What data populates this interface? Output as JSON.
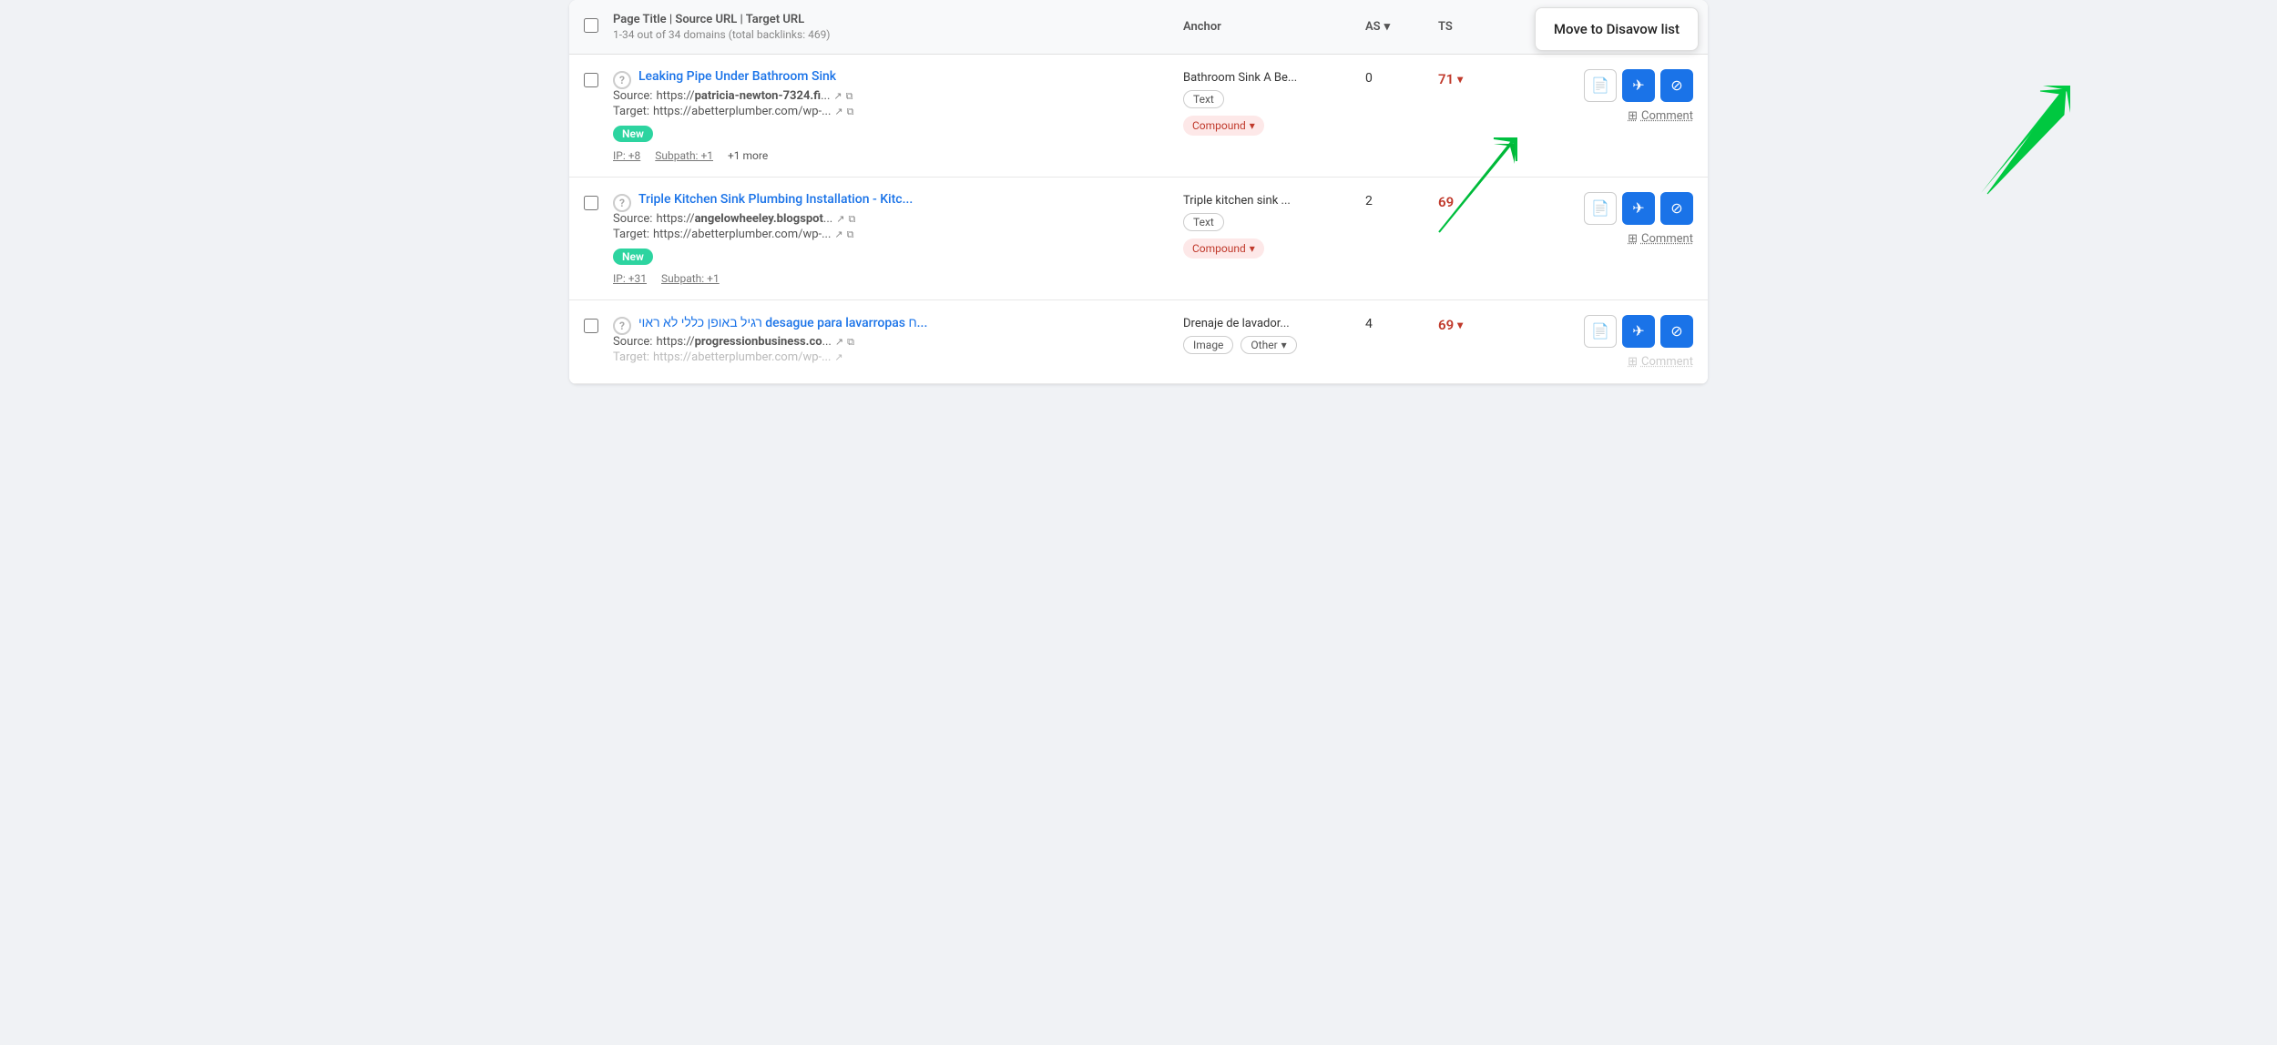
{
  "header": {
    "checkbox_label": "select-all",
    "title": "Page Title | Source URL | Target URL",
    "subtitle": "1-34 out of 34 domains (total backlinks: 469)",
    "anchor_col": "Anchor",
    "as_col": "AS",
    "ts_col": "TS",
    "disavow_tooltip": "Move to Disavow list"
  },
  "rows": [
    {
      "id": "row-1",
      "title": "Leaking Pipe Under Bathroom Sink",
      "source_label": "Source:",
      "source_prefix": "https://",
      "source_bold": "patricia-newton-7324.fi",
      "source_suffix": "...",
      "target_label": "Target:",
      "target_url": "https://abetterplumber.com/wp-...",
      "badge_new": "New",
      "ip": "IP: +8",
      "subpath": "Subpath: +1",
      "more": "+1 more",
      "anchor": "Bathroom Sink A Be...",
      "type1": "Text",
      "type2": "Compound",
      "as_value": "0",
      "ts_value": "71",
      "comment": "Comment",
      "comment_enabled": true
    },
    {
      "id": "row-2",
      "title": "Triple Kitchen Sink Plumbing Installation - Kitc...",
      "source_label": "Source:",
      "source_prefix": "https://",
      "source_bold": "angelowheeley.blogspot",
      "source_suffix": "...",
      "target_label": "Target:",
      "target_url": "https://abetterplumber.com/wp-...",
      "badge_new": "New",
      "ip": "IP: +31",
      "subpath": "Subpath: +1",
      "more": null,
      "anchor": "Triple kitchen sink ...",
      "type1": "Text",
      "type2": "Compound",
      "as_value": "2",
      "ts_value": "69",
      "comment": "Comment",
      "comment_enabled": true
    },
    {
      "id": "row-3",
      "title": "רגיל באופן כללי לא ראוי desague para lavarropas ח...",
      "source_label": "Source:",
      "source_prefix": "https://",
      "source_bold": "progressionbusiness.co",
      "source_suffix": "...",
      "target_label": "Target:",
      "target_url": "https://abetterplumber.com/wp-...",
      "badge_new": null,
      "ip": null,
      "subpath": null,
      "more": null,
      "anchor": "Drenaje de lavador...",
      "type1": "Image",
      "type2": "Other",
      "as_value": "4",
      "ts_value": "69",
      "comment": "Comment",
      "comment_enabled": false
    }
  ],
  "icons": {
    "external_link": "↗",
    "copy": "⧉",
    "help": "?",
    "chevron_down": "▼",
    "page_icon": "📄",
    "send_icon": "✈",
    "block_icon": "⊘",
    "comment_icon": "⊞"
  }
}
